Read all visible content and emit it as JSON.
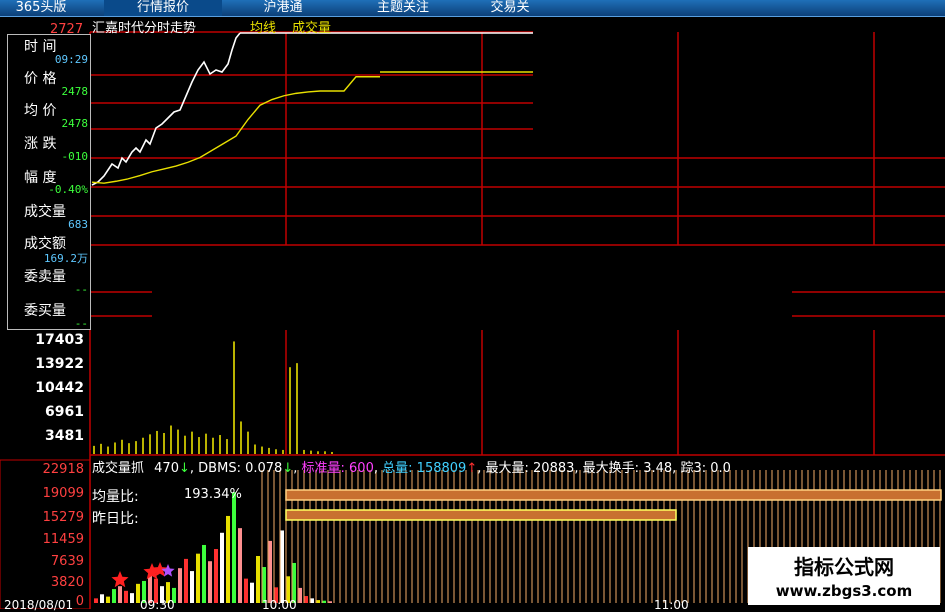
{
  "tabs": [
    "365头版",
    "行情报价",
    "沪港通",
    "主题关注",
    "交易关"
  ],
  "chart_title": "汇嘉时代分时走势",
  "title_avg_label": "均线",
  "title_vol_label": "成交量",
  "top_price_label": "2727",
  "info": {
    "time_label": "时 间",
    "time_value": "09:29",
    "price_label": "价 格",
    "price_value": "2478",
    "avg_label": "均 价",
    "avg_value": "2478",
    "change_label": "涨 跌",
    "change_value": "-010",
    "pct_label": "幅 度",
    "pct_value": "-0.40%",
    "vol_label": "成交量",
    "vol_value": "683",
    "amt_label": "成交额",
    "amt_value": "169.2万",
    "ask_label": "委卖量",
    "ask_value": "--",
    "bid_label": "委买量",
    "bid_value": "--"
  },
  "volume_ticks": [
    "17403",
    "13922",
    "10442",
    "6961",
    "3481"
  ],
  "indicator_ticks": [
    "22918",
    "19099",
    "15279",
    "11459",
    "7639",
    "3820",
    "0"
  ],
  "indicator_line": {
    "name": "成交量抓",
    "value1": "470",
    "dbms_label": "DBMS:",
    "dbms_value": "0.078",
    "standard_label": "标准量:",
    "standard_value": "600",
    "total_label": "总量:",
    "total_value": "158809",
    "max_label": "最大量:",
    "max_value": "20883",
    "max_turnover_label": "最大换手:",
    "max_turnover_value": "3.48",
    "track_label": "踪3:",
    "track_value": "0.0"
  },
  "avg_ratio_label": "均量比:",
  "avg_ratio_value": "193.34%",
  "yesterday_ratio_label": "昨日比:",
  "bottom_time_labels": [
    "2018/08/01",
    "09:30",
    "10:00",
    "11:00"
  ],
  "watermark": {
    "line1": "指标公式网",
    "line2": "www.zbgs3.com"
  },
  "colors": {
    "grid": "#c00000",
    "price": "#ffffff",
    "avg": "#e8e000",
    "volume": "#e8e000",
    "accent_red": "#ff2020"
  },
  "chart_data": [
    {
      "type": "line",
      "title": "汇嘉时代分时走势",
      "series": [
        {
          "name": "均线",
          "values": [
            2478,
            2476,
            2480,
            2485,
            2492,
            2500,
            2506,
            2512,
            2520,
            2530,
            2545,
            2560,
            2575,
            2610,
            2640,
            2652,
            2660,
            2665,
            2668,
            2670,
            2670,
            2670,
            2700,
            2700,
            2700
          ]
        }
      ]
    },
    {
      "type": "bar",
      "title": "成交量",
      "ylim": [
        0,
        17403
      ],
      "values": [
        1200,
        1500,
        1100,
        1700,
        2100,
        1600,
        1900,
        2400,
        2900,
        3400,
        3100,
        4200,
        3600,
        2700,
        3300,
        2500,
        3000,
        2400,
        2800,
        2200,
        16600,
        4800,
        3300,
        1400,
        1100,
        900,
        700,
        600,
        12800,
        13400,
        600,
        500,
        400,
        400,
        300
      ]
    },
    {
      "type": "bar",
      "title": "成交量抓",
      "ylim": [
        0,
        22918
      ],
      "values": [
        800,
        1500,
        1100,
        2400,
        2900,
        2100,
        1700,
        3300,
        3800,
        4700,
        4200,
        2900,
        3600,
        2600,
        6000,
        7600,
        5500,
        8500,
        10000,
        7200,
        9300,
        12100,
        15000,
        19099,
        12900,
        4200,
        3500,
        8100,
        6200,
        10700,
        2700,
        12500,
        4600,
        6900,
        2600,
        1200,
        800,
        500,
        400,
        300
      ]
    }
  ]
}
